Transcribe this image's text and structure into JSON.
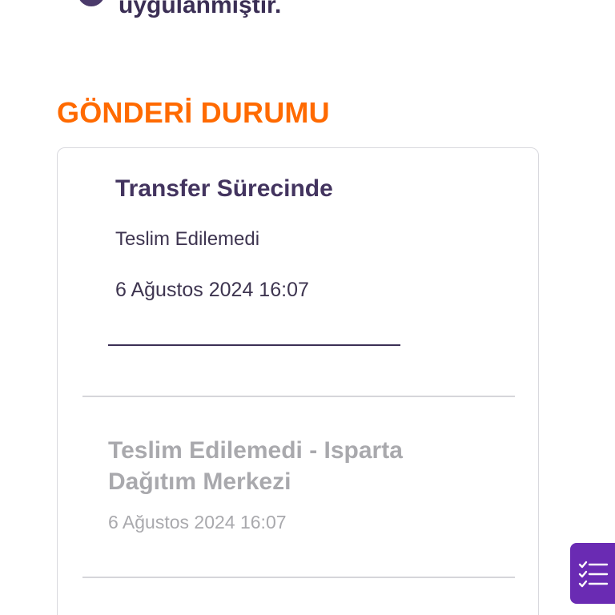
{
  "header": {
    "partial_text": "uygulanmıştır."
  },
  "section": {
    "title": "GÖNDERİ DURUMU"
  },
  "status_card": {
    "current": {
      "status": "Transfer Sürecinde",
      "substatus": "Teslim Edilemedi",
      "datetime": "6 Ağustos 2024 16:07"
    },
    "history": [
      {
        "title": "Teslim Edilemedi - Isparta Dağıtım Merkezi",
        "datetime": "6 Ağustos 2024 16:07"
      }
    ]
  },
  "fab": {
    "icon": "checklist-icon"
  },
  "colors": {
    "accent_orange": "#ff6a00",
    "primary_purple": "#43345f",
    "fab_purple": "#6a2bb3",
    "muted_gray": "#a9a9ad"
  }
}
